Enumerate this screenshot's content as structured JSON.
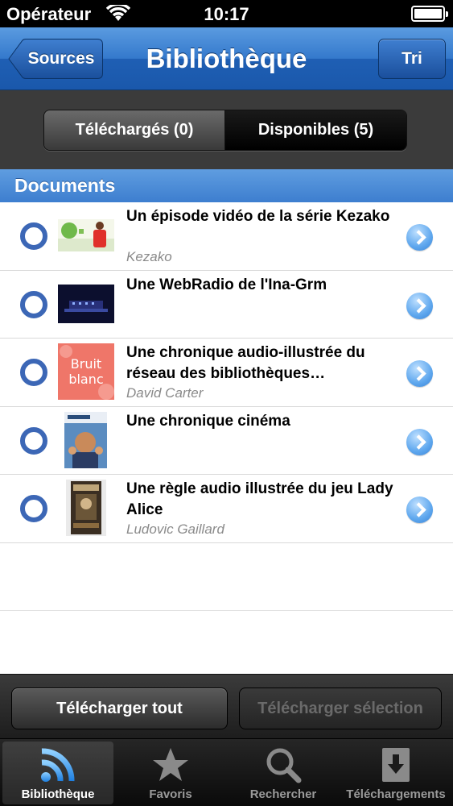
{
  "status_bar": {
    "carrier": "Opérateur",
    "time": "10:17"
  },
  "nav": {
    "back_label": "Sources",
    "title": "Bibliothèque",
    "right_label": "Tri"
  },
  "segments": {
    "left": "Téléchargés (0)",
    "right": "Disponibles (5)"
  },
  "section_title": "Documents",
  "items": [
    {
      "title": "Un épisode vidéo de la série Kezako",
      "author": "Kezako",
      "thumb_icon": "kezako-thumbnail"
    },
    {
      "title": "Une WebRadio de l'Ina-Grm",
      "author": "",
      "thumb_icon": "webradio-thumbnail"
    },
    {
      "title": "Une chronique audio-illustrée du réseau des bibliothèques Valenciennes",
      "author": "David Carter",
      "thumb_icon": "bruit-blanc-thumbnail",
      "thumb_text_1": "Bruit",
      "thumb_text_2": "blanc"
    },
    {
      "title": "Une chronique cinéma",
      "author": "",
      "thumb_icon": "cinema-thumbnail"
    },
    {
      "title": "Une règle audio illustrée du jeu Lady Alice",
      "author": "Ludovic Gaillard",
      "thumb_icon": "lady-alice-thumbnail"
    }
  ],
  "toolbar": {
    "download_all": "Télécharger tout",
    "download_selection": "Télécharger sélection"
  },
  "tabs": [
    {
      "label": "Bibliothèque",
      "icon": "rss-icon",
      "active": true
    },
    {
      "label": "Favoris",
      "icon": "star-icon",
      "active": false
    },
    {
      "label": "Rechercher",
      "icon": "search-icon",
      "active": false
    },
    {
      "label": "Téléchargements",
      "icon": "download-icon",
      "active": false
    }
  ],
  "colors": {
    "nav_blue": "#3479cc",
    "section_blue": "#4a8ad6",
    "radio_blue": "#3c67b6",
    "chevron_blue": "#5ea7ee"
  }
}
